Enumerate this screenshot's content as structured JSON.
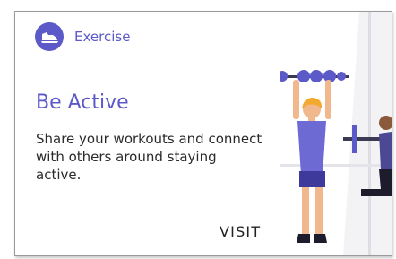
{
  "colors": {
    "accent": "#5c59c9",
    "bg_light": "#f3f3f5",
    "bg_wall": "#e9e9ed",
    "skin": "#f0b88c",
    "hair": "#f3a830",
    "dark": "#1c1c2c"
  },
  "card": {
    "category_icon": "sneaker-icon",
    "category_label": "Exercise",
    "title": "Be Active",
    "description": "Share your workouts and connect with others around staying active.",
    "action_label": "VISIT",
    "illustration": "weightlifting-illustration"
  }
}
